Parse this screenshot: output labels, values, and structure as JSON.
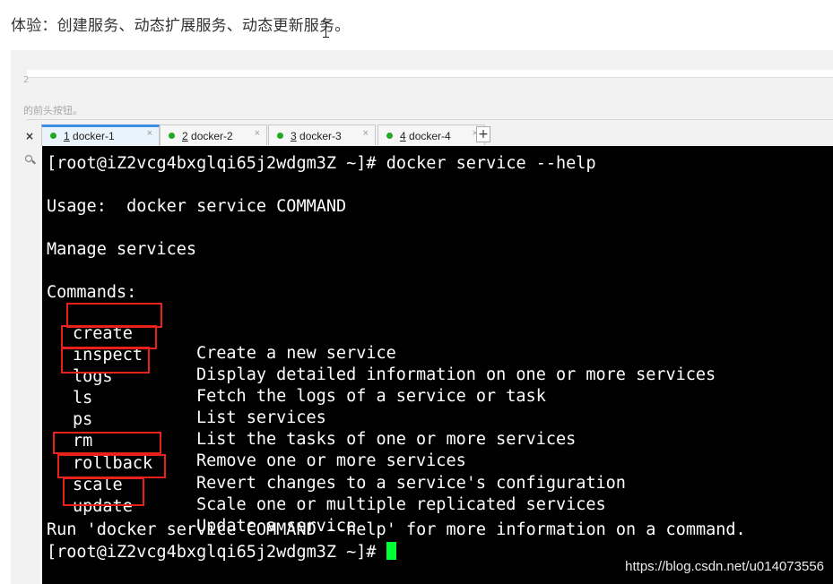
{
  "heading": "体验：创建服务、动态扩展服务、动态更新服务。",
  "background_window": {
    "fragment_text": "2",
    "hint_text": "的前头按钮。",
    "close_label": "×"
  },
  "tabs": [
    {
      "number": "1",
      "name": "docker-1",
      "active": true,
      "close": "×"
    },
    {
      "number": "2",
      "name": "docker-2",
      "active": false,
      "close": "×"
    },
    {
      "number": "3",
      "name": "docker-3",
      "active": false,
      "close": "×"
    },
    {
      "number": "4",
      "name": "docker-4",
      "active": false,
      "close": "×"
    }
  ],
  "add_tab_label": "+",
  "terminal": {
    "prompt_command": "[root@iZ2vcg4bxglqi65j2wdgm3Z ~]# docker service --help",
    "usage": "Usage:  docker service COMMAND",
    "manage": "Manage services",
    "commands_header": "Commands:",
    "commands": [
      {
        "name": "create",
        "desc": "Create a new service",
        "highlight": true
      },
      {
        "name": "inspect",
        "desc": "Display detailed information on one or more services",
        "highlight": true
      },
      {
        "name": "logs",
        "desc": "Fetch the logs of a service or task",
        "highlight": true
      },
      {
        "name": "ls",
        "desc": "List services",
        "highlight": false
      },
      {
        "name": "ps",
        "desc": "List the tasks of one or more services",
        "highlight": false
      },
      {
        "name": "rm",
        "desc": "Remove one or more services",
        "highlight": false
      },
      {
        "name": "rollback",
        "desc": "Revert changes to a service's configuration",
        "highlight": true
      },
      {
        "name": "scale",
        "desc": "Scale one or multiple replicated services",
        "highlight": true
      },
      {
        "name": "update",
        "desc": "Update a service",
        "highlight": true
      }
    ],
    "footer": "Run 'docker service COMMAND --help' for more information on a command.",
    "final_prompt": "[root@iZ2vcg4bxglqi65j2wdgm3Z ~]# "
  },
  "watermark": "https://blog.csdn.net/u014073556",
  "colors": {
    "terminal_bg": "#000000",
    "terminal_fg": "#ffffff",
    "highlight_box": "#e8211b",
    "cursor": "#00ff33",
    "active_tab_accent": "#3c8ee0",
    "tab_dot": "#22a722"
  }
}
